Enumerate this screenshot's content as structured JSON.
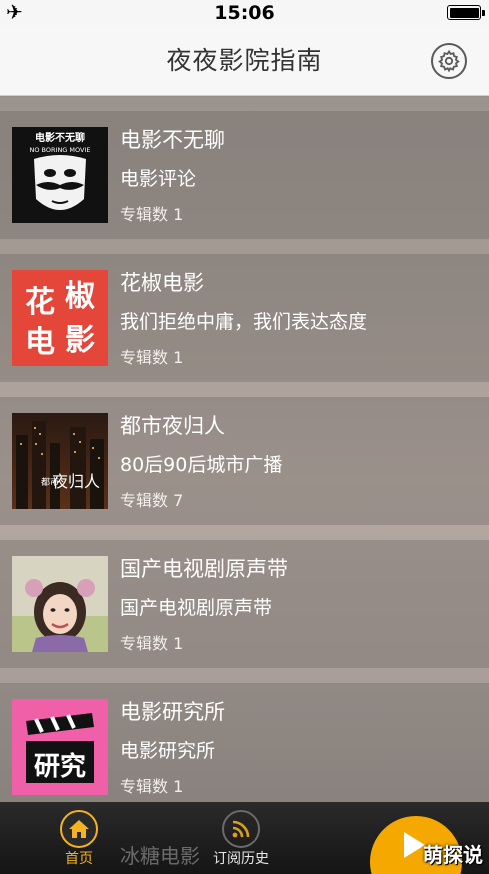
{
  "status_bar": {
    "time": "15:06",
    "airplane_icon": "airplane-icon",
    "battery_icon": "battery-icon"
  },
  "nav": {
    "title": "夜夜影院指南",
    "settings_icon": "gear-icon"
  },
  "list": [
    {
      "title": "电影不无聊",
      "description": "电影评论",
      "count": "专辑数 1",
      "cover": {
        "text_line1": "电影不无聊",
        "text_line2": "NO BORING MOVIE",
        "bg": "#111111"
      }
    },
    {
      "title": "花椒电影",
      "description": "我们拒绝中庸，我们表达态度",
      "count": "专辑数 1",
      "cover": {
        "text_line1": "花椒",
        "text_line2": "电影",
        "bg": "#e4473a"
      }
    },
    {
      "title": "都市夜归人",
      "description": "80后90后城市广播",
      "count": "专辑数 7",
      "cover": {
        "text_line1": "都市",
        "text_line2": "夜归人",
        "bg": "#3a2418"
      }
    },
    {
      "title": "国产电视剧原声带",
      "description": "国产电视剧原声带",
      "count": "专辑数 1",
      "cover": {
        "bg": "#d7d3c4"
      }
    },
    {
      "title": "电影研究所",
      "description": "电影研究所",
      "count": "专辑数 1",
      "cover": {
        "bg": "#f060a8"
      }
    }
  ],
  "tab_bar": {
    "peek_text": "冰糖电影",
    "home_label": "首页",
    "history_label": "订阅历史",
    "home_icon": "home-icon",
    "history_icon": "rss-icon",
    "play_icon": "play-icon"
  },
  "watermark": "萌探说",
  "colors": {
    "accent": "#f3b323",
    "play": "#f5a800"
  }
}
